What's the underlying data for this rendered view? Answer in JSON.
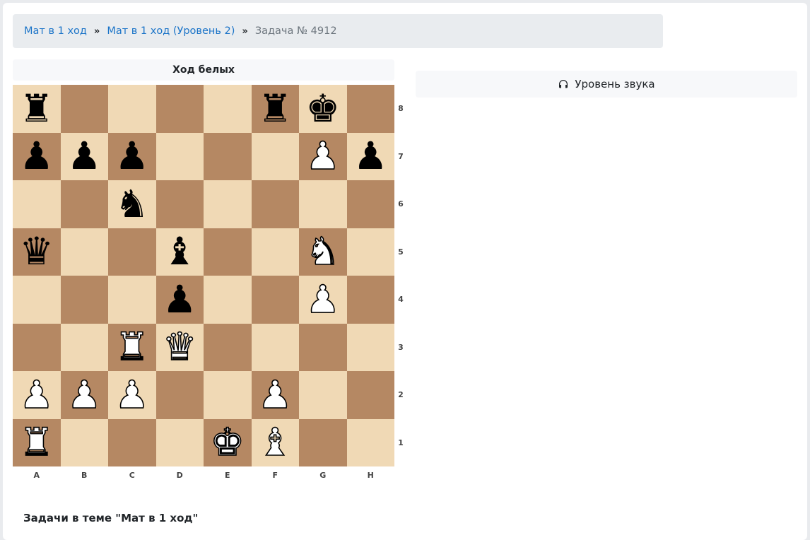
{
  "breadcrumb": {
    "item1": "Мат в 1 ход",
    "item2": "Мат в 1 ход (Уровень 2)",
    "current": "Задача № 4912",
    "separator": "»"
  },
  "board": {
    "turn_label": "Ход белых",
    "files": [
      "A",
      "B",
      "C",
      "D",
      "E",
      "F",
      "G",
      "H"
    ],
    "ranks": [
      "8",
      "7",
      "6",
      "5",
      "4",
      "3",
      "2",
      "1"
    ],
    "position": [
      [
        "bR",
        "",
        "",
        "",
        "",
        "bR",
        "bK",
        ""
      ],
      [
        "bP",
        "bP",
        "bP",
        "",
        "",
        "",
        "wP",
        "bP"
      ],
      [
        "",
        "",
        "bN",
        "",
        "",
        "",
        "",
        ""
      ],
      [
        "bQ",
        "",
        "",
        "bB",
        "",
        "",
        "wN",
        ""
      ],
      [
        "",
        "",
        "",
        "bP",
        "",
        "",
        "wP",
        ""
      ],
      [
        "",
        "",
        "wR",
        "wQ",
        "",
        "",
        "",
        ""
      ],
      [
        "wP",
        "wP",
        "wP",
        "",
        "",
        "wP",
        "",
        ""
      ],
      [
        "wR",
        "",
        "",
        "",
        "wK",
        "wB",
        "",
        ""
      ]
    ]
  },
  "sound": {
    "label": "Уровень звука",
    "icon": "headphones-icon"
  },
  "topic_heading": "Задачи в теме \"Мат в 1 ход\"",
  "colors": {
    "light_square": "#f0d9b5",
    "dark_square": "#b58863",
    "link": "#1b74c8"
  }
}
